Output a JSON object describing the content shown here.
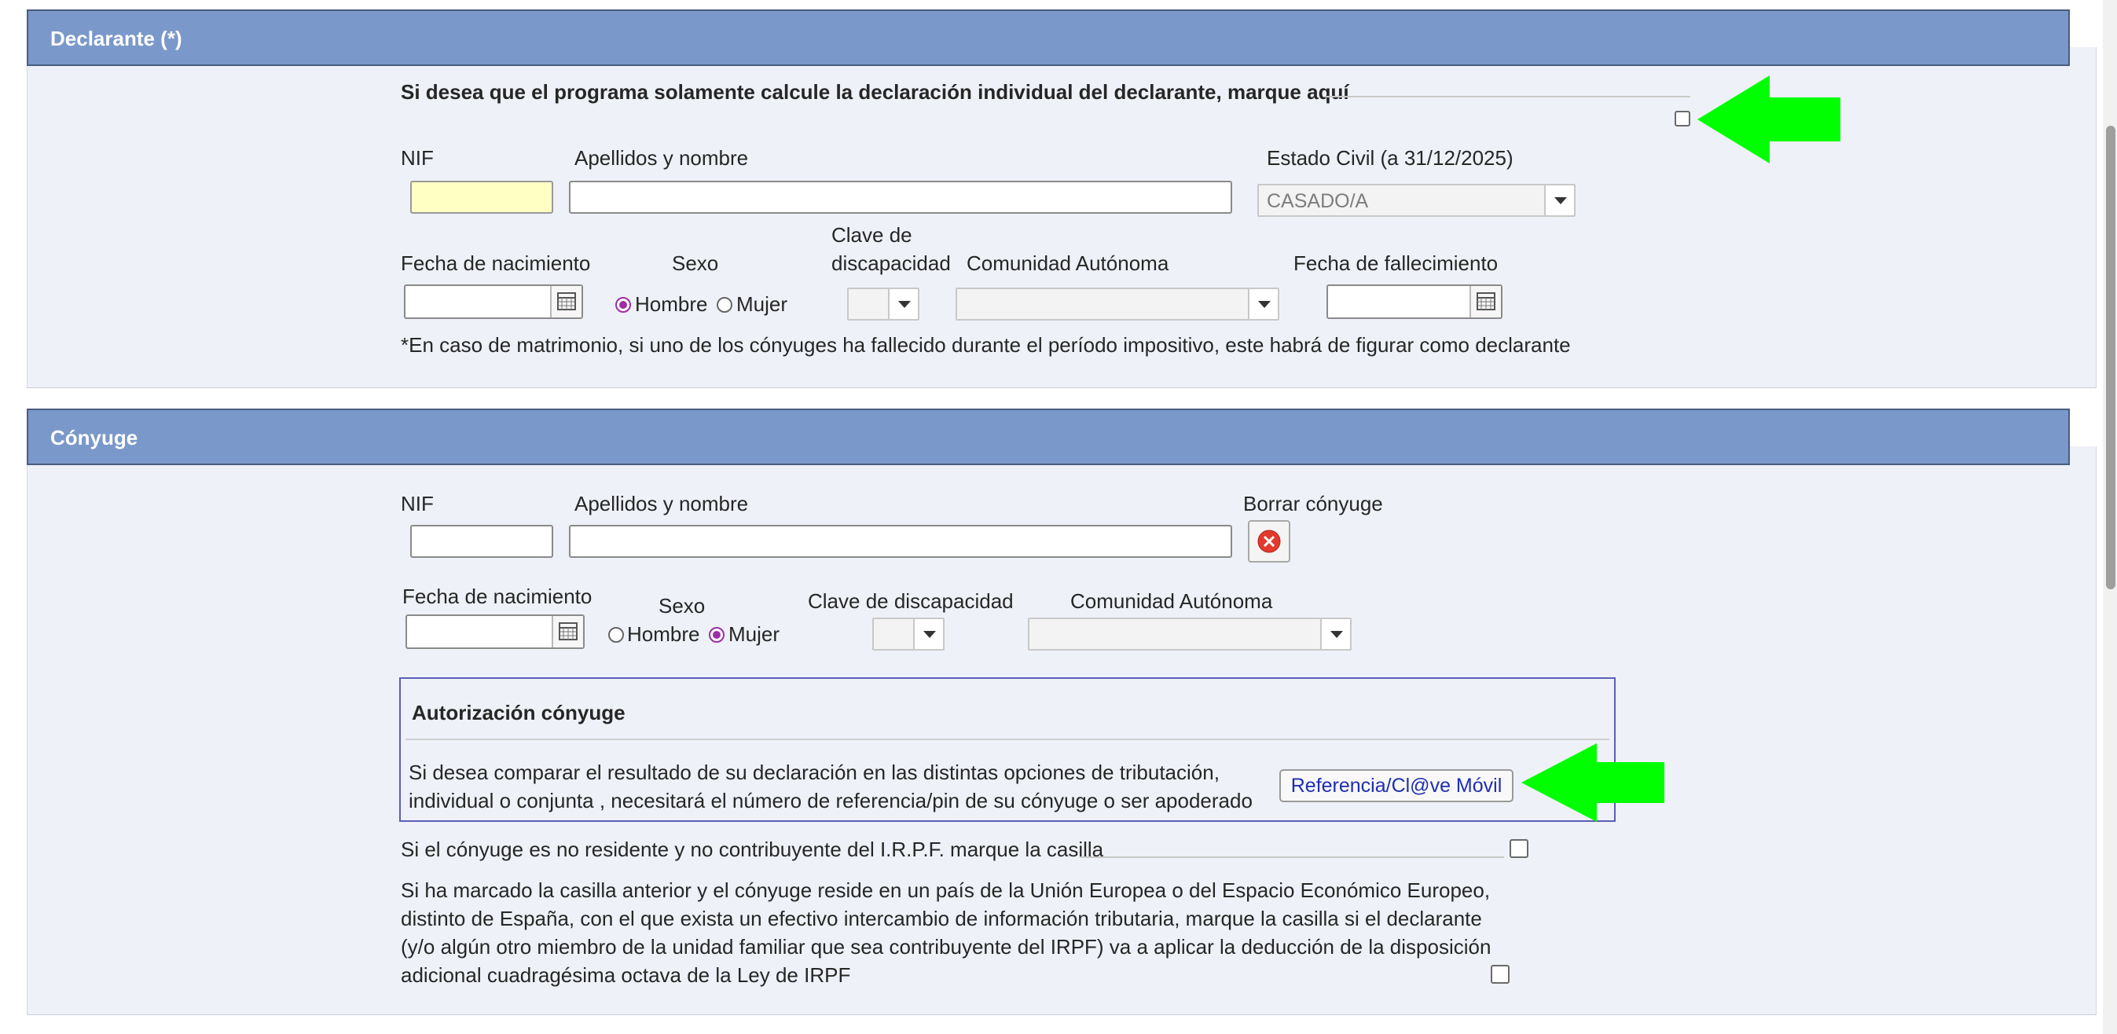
{
  "declarante": {
    "header": "Declarante (*)",
    "individual_text": "Si desea que el programa solamente calcule la declaración individual del declarante, marque aquí",
    "nif_label": "NIF",
    "nif_value": "",
    "nombre_label": "Apellidos y nombre",
    "nombre_value": "",
    "estado_civil_label": "Estado Civil (a 31/12/2025)",
    "estado_civil_value": "CASADO/A",
    "fecha_nac_label": "Fecha de nacimiento",
    "sexo_label": "Sexo",
    "sexo_options": [
      "Hombre",
      "Mujer"
    ],
    "sexo_selected": "Hombre",
    "discapacidad_label_1": "Clave de",
    "discapacidad_label_2": "discapacidad",
    "comunidad_label": "Comunidad Autónoma",
    "fecha_fall_label": "Fecha de fallecimiento",
    "note": "*En caso de matrimonio, si uno de los cónyuges ha fallecido durante el período impositivo, este habrá de figurar como declarante"
  },
  "conyuge": {
    "header": "Cónyuge",
    "nif_label": "NIF",
    "nombre_label": "Apellidos y nombre",
    "borrar_label": "Borrar cónyuge",
    "fecha_nac_label": "Fecha de nacimiento",
    "sexo_label": "Sexo",
    "sexo_options": [
      "Hombre",
      "Mujer"
    ],
    "sexo_selected": "Mujer",
    "discapacidad_label": "Clave de discapacidad",
    "comunidad_label": "Comunidad Autónoma",
    "autorizacion_title": "Autorización cónyuge",
    "autorizacion_text_1": "Si desea comparar el resultado de su declaración en las distintas opciones de tributación,",
    "autorizacion_text_2": "individual o conjunta , necesitará el número de referencia/pin de su cónyuge o ser apoderado",
    "ref_button": "Referencia/Cl@ve Móvil",
    "no_residente_text": "Si el cónyuge es no residente y no contribuyente del I.R.P.F. marque la casilla",
    "ue_text_1": "Si ha marcado la casilla anterior y el cónyuge reside en un país de la Unión Europea o del Espacio Económico Europeo,",
    "ue_text_2": "distinto de España, con el que exista un efectivo intercambio de información tributaria, marque la casilla si el declarante",
    "ue_text_3": "(y/o algún otro miembro de la unidad familiar que sea contribuyente del IRPF) va a aplicar la deducción de la disposición",
    "ue_text_4": "adicional cuadragésima octava de la Ley de IRPF"
  },
  "icons": {
    "calendar": "calendar-icon",
    "delete": "delete-icon",
    "arrow": "green-arrow-icon"
  },
  "colors": {
    "header_bg": "#7a98c9",
    "panel_bg": "#eef1f7",
    "arrow": "#00ff00",
    "radio_selected": "#9c2ea8",
    "link": "#1e2fb0"
  }
}
